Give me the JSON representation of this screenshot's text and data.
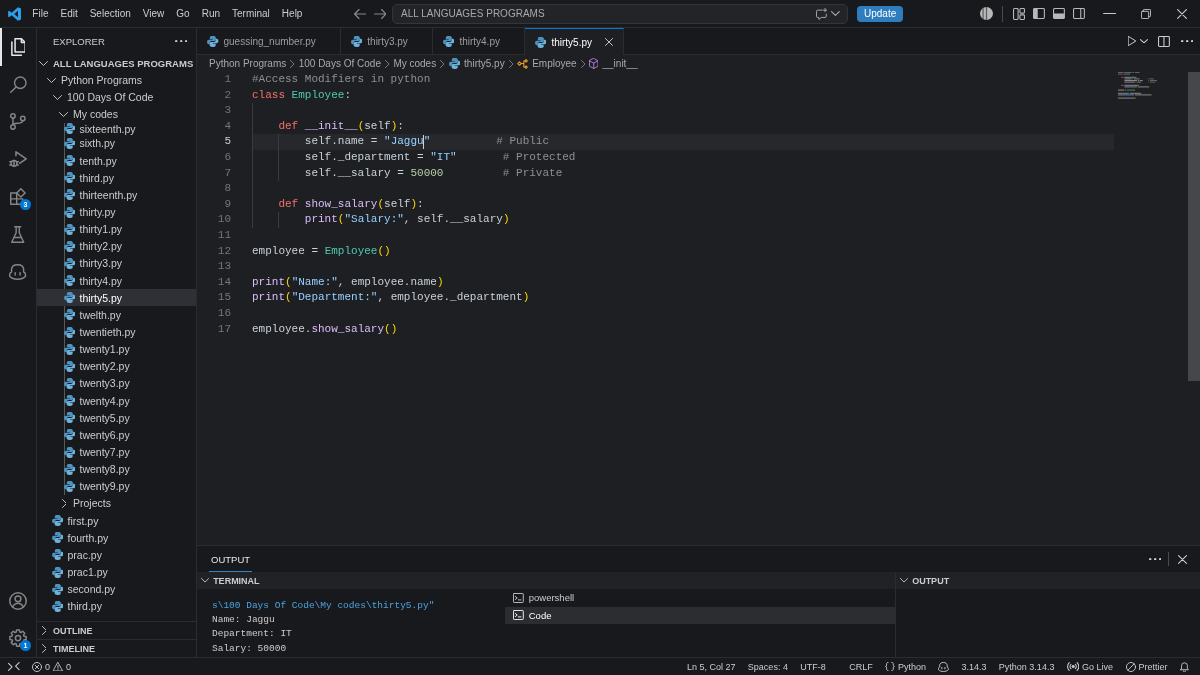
{
  "title_bar": {
    "menus": [
      "File",
      "Edit",
      "Selection",
      "View",
      "Go",
      "Run",
      "Terminal",
      "Help"
    ],
    "command_center": {
      "value": "ALL LANGUAGES PROGRAMS"
    },
    "update_button": "Update"
  },
  "activity_bar": {
    "items": [
      {
        "kind": "explorer",
        "selected": true
      },
      {
        "kind": "search",
        "selected": false
      },
      {
        "kind": "source_control",
        "selected": false
      },
      {
        "kind": "run_debug",
        "selected": false
      },
      {
        "kind": "extensions",
        "selected": false,
        "badge": "3"
      },
      {
        "kind": "testing",
        "selected": false
      },
      {
        "kind": "copilot",
        "selected": false
      }
    ],
    "bottom": [
      {
        "kind": "accounts"
      },
      {
        "kind": "settings",
        "badge": "1"
      }
    ]
  },
  "sidebar": {
    "title": "EXPLORER",
    "tree": {
      "label": "ALL LANGUAGES PROGRAMS",
      "kind": "folder",
      "expanded": true,
      "selected": false,
      "children": [
        {
          "label": "Python Programs",
          "kind": "folder",
          "expanded": true,
          "selected": false,
          "children": [
            {
              "label": "100 Days Of Code",
              "kind": "folder",
              "expanded": true,
              "selected": false,
              "children": [
                {
                  "label": "My codes",
                  "kind": "folder",
                  "expanded": true,
                  "selected": false,
                  "children": [
                    {
                      "label": "sixteenth.py",
                      "kind": "file",
                      "selected": false
                    },
                    {
                      "label": "sixth.py",
                      "kind": "file",
                      "selected": false
                    },
                    {
                      "label": "tenth.py",
                      "kind": "file",
                      "selected": false
                    },
                    {
                      "label": "third.py",
                      "kind": "file",
                      "selected": false
                    },
                    {
                      "label": "thirteenth.py",
                      "kind": "file",
                      "selected": false
                    },
                    {
                      "label": "thirty.py",
                      "kind": "file",
                      "selected": false
                    },
                    {
                      "label": "thirty1.py",
                      "kind": "file",
                      "selected": false
                    },
                    {
                      "label": "thirty2.py",
                      "kind": "file",
                      "selected": false
                    },
                    {
                      "label": "thirty3.py",
                      "kind": "file",
                      "selected": false
                    },
                    {
                      "label": "thirty4.py",
                      "kind": "file",
                      "selected": false
                    },
                    {
                      "label": "thirty5.py",
                      "kind": "file",
                      "selected": true
                    },
                    {
                      "label": "twelth.py",
                      "kind": "file",
                      "selected": false
                    },
                    {
                      "label": "twentieth.py",
                      "kind": "file",
                      "selected": false
                    },
                    {
                      "label": "twenty1.py",
                      "kind": "file",
                      "selected": false
                    },
                    {
                      "label": "twenty2.py",
                      "kind": "file",
                      "selected": false
                    },
                    {
                      "label": "twenty3.py",
                      "kind": "file",
                      "selected": false
                    },
                    {
                      "label": "twenty4.py",
                      "kind": "file",
                      "selected": false
                    },
                    {
                      "label": "twenty5.py",
                      "kind": "file",
                      "selected": false
                    },
                    {
                      "label": "twenty6.py",
                      "kind": "file",
                      "selected": false
                    },
                    {
                      "label": "twenty7.py",
                      "kind": "file",
                      "selected": false
                    },
                    {
                      "label": "twenty8.py",
                      "kind": "file",
                      "selected": false
                    },
                    {
                      "label": "twenty9.py",
                      "kind": "file",
                      "selected": false
                    }
                  ]
                },
                {
                  "label": "Projects",
                  "kind": "folder",
                  "expanded": false,
                  "selected": false
                }
              ]
            },
            {
              "label": "first.py",
              "kind": "file",
              "selected": false
            },
            {
              "label": "fourth.py",
              "kind": "file",
              "selected": false
            },
            {
              "label": "prac.py",
              "kind": "file",
              "selected": false
            },
            {
              "label": "prac1.py",
              "kind": "file",
              "selected": false
            },
            {
              "label": "second.py",
              "kind": "file",
              "selected": false
            },
            {
              "label": "third.py",
              "kind": "file",
              "selected": false
            }
          ]
        }
      ]
    },
    "sections": [
      {
        "label": "OUTLINE",
        "expanded": false
      },
      {
        "label": "TIMELINE",
        "expanded": false
      }
    ]
  },
  "editor": {
    "tabs": [
      {
        "label": "guessing_number.py",
        "selected": false
      },
      {
        "label": "thirty3.py",
        "selected": false
      },
      {
        "label": "thirty4.py",
        "selected": false
      },
      {
        "label": "thirty5.py",
        "selected": true
      }
    ],
    "breadcrumbs": [
      {
        "kind": "folder",
        "text": "Python Programs"
      },
      {
        "kind": "folder",
        "text": "100 Days Of Code"
      },
      {
        "kind": "folder",
        "text": "My codes"
      },
      {
        "kind": "python_file",
        "text": "thirty5.py"
      },
      {
        "kind": "class",
        "text": "Employee"
      },
      {
        "kind": "method",
        "text": "__init__"
      }
    ],
    "lines": [
      {
        "number": "1",
        "current": false,
        "tokens": [
          {
            "kind": "comment",
            "text": "#Access Modifiers in python"
          }
        ]
      },
      {
        "number": "2",
        "current": false,
        "tokens": [
          {
            "kind": "keyword",
            "text": "class "
          },
          {
            "kind": "class",
            "text": "Employee"
          },
          {
            "kind": "plain",
            "text": ":"
          }
        ]
      },
      {
        "number": "3",
        "current": false
      },
      {
        "number": "4",
        "current": false,
        "tokens": [
          {
            "kind": "keyword",
            "text": "    def "
          },
          {
            "kind": "function",
            "text": "__init__"
          },
          {
            "kind": "bracket",
            "text": "("
          },
          {
            "kind": "plain",
            "text": "self"
          },
          {
            "kind": "bracket",
            "text": ")"
          },
          {
            "kind": "plain",
            "text": ":"
          }
        ]
      },
      {
        "number": "5",
        "current": true,
        "tokens": [
          {
            "kind": "plain",
            "text": "        self.name = ",
            "caret": false
          },
          {
            "kind": "string",
            "text": "\"Jaggu",
            "caret": true
          },
          {
            "kind": "string",
            "text": "\"",
            "caret": false
          },
          {
            "kind": "comment",
            "text": "          # Public",
            "caret": false
          }
        ]
      },
      {
        "number": "6",
        "current": false,
        "tokens": [
          {
            "kind": "plain",
            "text": "        self._department = "
          },
          {
            "kind": "string",
            "text": "\"IT\""
          },
          {
            "kind": "comment",
            "text": "       # Protected"
          }
        ]
      },
      {
        "number": "7",
        "current": false,
        "tokens": [
          {
            "kind": "plain",
            "text": "        self.__salary = "
          },
          {
            "kind": "number",
            "text": "50000"
          },
          {
            "kind": "comment",
            "text": "         # Private"
          }
        ]
      },
      {
        "number": "8",
        "current": false
      },
      {
        "number": "9",
        "current": false,
        "tokens": [
          {
            "kind": "keyword",
            "text": "    def "
          },
          {
            "kind": "function",
            "text": "show_salary"
          },
          {
            "kind": "bracket",
            "text": "("
          },
          {
            "kind": "plain",
            "text": "self"
          },
          {
            "kind": "bracket",
            "text": ")"
          },
          {
            "kind": "plain",
            "text": ":"
          }
        ]
      },
      {
        "number": "10",
        "current": false,
        "tokens": [
          {
            "kind": "function",
            "text": "        print"
          },
          {
            "kind": "bracket",
            "text": "("
          },
          {
            "kind": "string",
            "text": "\"Salary:\""
          },
          {
            "kind": "plain",
            "text": ", self.__salary"
          },
          {
            "kind": "bracket",
            "text": ")"
          }
        ]
      },
      {
        "number": "11",
        "current": false
      },
      {
        "number": "12",
        "current": false,
        "tokens": [
          {
            "kind": "plain",
            "text": "employee = "
          },
          {
            "kind": "class",
            "text": "Employee"
          },
          {
            "kind": "bracket",
            "text": "()"
          }
        ]
      },
      {
        "number": "13",
        "current": false
      },
      {
        "number": "14",
        "current": false,
        "tokens": [
          {
            "kind": "function",
            "text": "print"
          },
          {
            "kind": "bracket",
            "text": "("
          },
          {
            "kind": "string",
            "text": "\"Name:\""
          },
          {
            "kind": "plain",
            "text": ", employee.name"
          },
          {
            "kind": "bracket",
            "text": ")"
          }
        ]
      },
      {
        "number": "15",
        "current": false,
        "tokens": [
          {
            "kind": "function",
            "text": "print"
          },
          {
            "kind": "bracket",
            "text": "("
          },
          {
            "kind": "string",
            "text": "\"Department:\""
          },
          {
            "kind": "plain",
            "text": ", employee._department"
          },
          {
            "kind": "bracket",
            "text": ")"
          }
        ]
      },
      {
        "number": "16",
        "current": false
      },
      {
        "number": "17",
        "current": false,
        "tokens": [
          {
            "kind": "plain",
            "text": "employee."
          },
          {
            "kind": "function",
            "text": "show_salary"
          },
          {
            "kind": "bracket",
            "text": "()"
          }
        ]
      }
    ]
  },
  "panel": {
    "tabs": [
      {
        "label": "OUTPUT",
        "selected": true
      }
    ],
    "terminal": {
      "title": "TERMINAL",
      "expanded": true,
      "lines": [
        {
          "kind": "path",
          "text": "s\\100 Days Of Code\\My codes\\thirty5.py\""
        },
        {
          "kind": "output",
          "text": "Name: Jaggu"
        },
        {
          "kind": "output",
          "text": "Department: IT"
        },
        {
          "kind": "output",
          "text": "Salary: 50000"
        }
      ],
      "sessions": [
        {
          "label": "powershell",
          "selected": false
        },
        {
          "label": "Code",
          "selected": true
        }
      ]
    },
    "output": {
      "title": "OUTPUT",
      "expanded": true
    }
  },
  "status_bar": {
    "problems": {
      "errors": "0",
      "warnings": "0"
    },
    "items": [
      {
        "kind": "position",
        "text": "Ln 5, Col 27"
      },
      {
        "kind": "indentation",
        "text": "Spaces: 4"
      },
      {
        "kind": "encoding",
        "text": "UTF-8"
      },
      {
        "kind": "eol",
        "text": "CRLF"
      },
      {
        "kind": "language",
        "text": "Python"
      },
      {
        "kind": "copilot"
      },
      {
        "kind": "version",
        "text": "3.14.3"
      },
      {
        "kind": "interpreter",
        "text": "Python 3.14.3"
      },
      {
        "kind": "live",
        "text": "Go Live"
      },
      {
        "kind": "formatter",
        "text": "Prettier"
      },
      {
        "kind": "notifications"
      }
    ]
  }
}
